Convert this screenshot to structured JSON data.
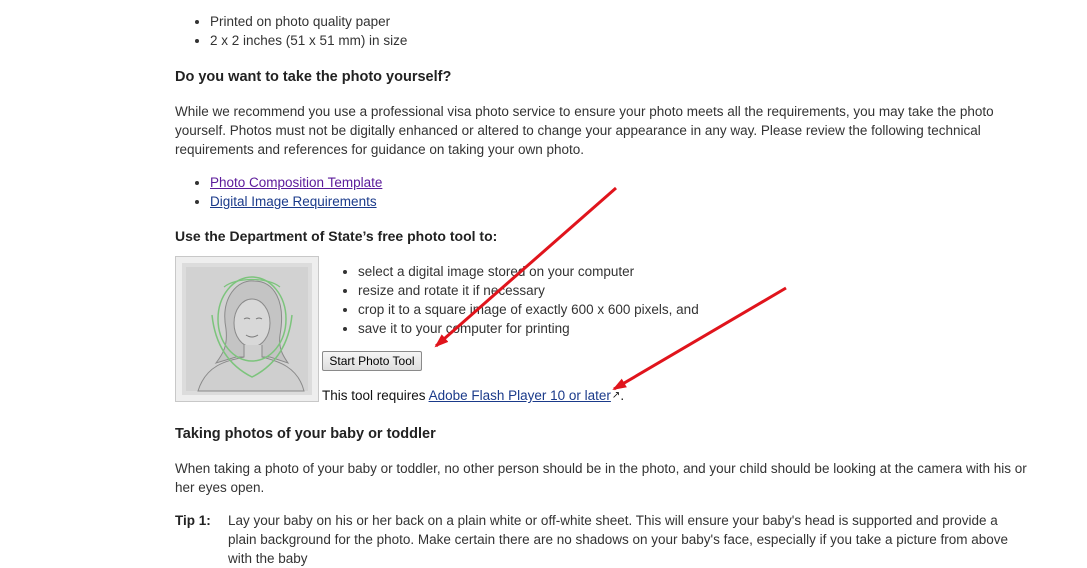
{
  "requirements": {
    "items": [
      "Printed on photo quality paper",
      "2 x 2 inches (51 x 51 mm) in size"
    ]
  },
  "self_photo": {
    "heading": "Do you want to take the photo yourself?",
    "paragraph": "While we recommend you use a professional visa photo service to ensure your photo meets all the requirements, you may take the photo yourself. Photos must not be digitally enhanced or altered to change your appearance in any way. Please review the following technical requirements and references for guidance on taking your own photo.",
    "links": [
      "Photo Composition Template",
      "Digital Image Requirements"
    ]
  },
  "photo_tool": {
    "heading": "Use the Department of State’s free photo tool to:",
    "steps": [
      "select a digital image stored on your computer",
      "resize and rotate it if necessary",
      "crop it to a square image of exactly 600 x 600 pixels, and",
      "save it to your computer for printing"
    ],
    "button_label": "Start Photo Tool",
    "requirement_prefix": "This tool requires ",
    "flash_link": "Adobe Flash Player 10 or later",
    "requirement_suffix": "."
  },
  "baby": {
    "heading": "Taking photos of your baby or toddler",
    "paragraph": "When taking a photo of your baby or toddler, no other person should be in the photo, and your child should be looking at the camera with his or her eyes open.",
    "tip_label": "Tip 1:",
    "tip_text": "Lay your baby on his or her back on a plain white or off-white sheet. This will ensure your baby's head is supported and provide a plain background for the photo. Make certain there are no shadows on your baby's face, especially if you take a picture from above with the baby"
  },
  "colors": {
    "arrow": "#e0141c",
    "link": "#1a3a8a",
    "visited_link": "#5b1a9a"
  }
}
